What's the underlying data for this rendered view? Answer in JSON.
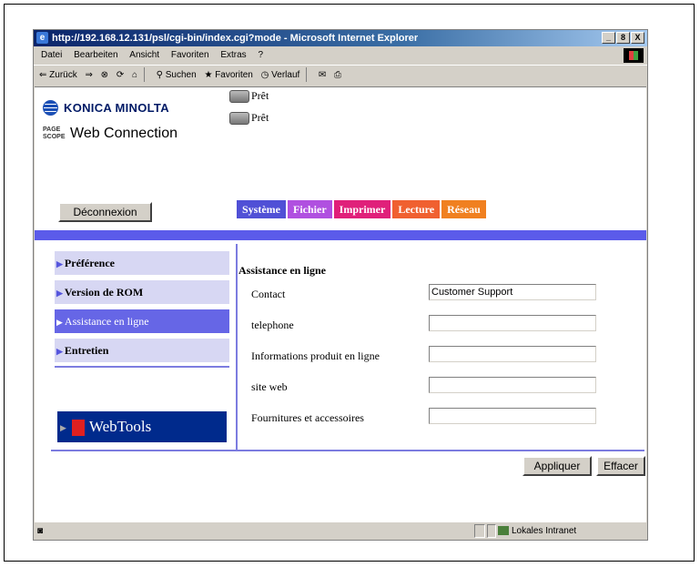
{
  "window": {
    "title": "http://192.168.12.131/psl/cgi-bin/index.cgi?mode - Microsoft Internet Explorer",
    "controls": [
      "_",
      "8",
      "X"
    ]
  },
  "menubar": [
    "Datei",
    "Bearbeiten",
    "Ansicht",
    "Favoriten",
    "Extras",
    "?"
  ],
  "toolbar": {
    "back": "⇐ Zurück",
    "forward": "⇒",
    "search": "Suchen",
    "favorites": "Favoriten",
    "history": "Verlauf"
  },
  "brand": {
    "company": "KONICA MINOLTA",
    "pagescope": "PAGE SCOPE",
    "product": "Web Connection"
  },
  "status": {
    "printer": "Prêt",
    "scanner": "Prêt"
  },
  "logout_button": "Déconnexion",
  "tabs": [
    {
      "label": "Système",
      "color": "#5050d6"
    },
    {
      "label": "Fichier",
      "color": "#b050e0"
    },
    {
      "label": "Imprimer",
      "color": "#e0207a"
    },
    {
      "label": "Lecture",
      "color": "#f06030"
    },
    {
      "label": "Réseau",
      "color": "#f08020"
    }
  ],
  "sidebar": {
    "items": [
      {
        "label": "Préférence"
      },
      {
        "label": "Version de ROM"
      },
      {
        "label": "Assistance en ligne"
      },
      {
        "label": "Entretien"
      }
    ],
    "webtools": "WebTools"
  },
  "form": {
    "heading": "Assistance en ligne",
    "fields": [
      {
        "label": "Contact",
        "value": "Customer Support"
      },
      {
        "label": "telephone",
        "value": ""
      },
      {
        "label": "Informations produit en ligne",
        "value": ""
      },
      {
        "label": "site web",
        "value": ""
      },
      {
        "label": "Fournitures et accessoires",
        "value": ""
      }
    ],
    "apply": "Appliquer",
    "clear": "Effacer"
  },
  "statusbar": {
    "zone": "Lokales Intranet"
  },
  "colors": {
    "accent_bar": "#5b5bea",
    "sidebar_item": "#d7d7f3",
    "sidebar_active": "#6666e6",
    "webtools_bg": "#002a8c"
  }
}
